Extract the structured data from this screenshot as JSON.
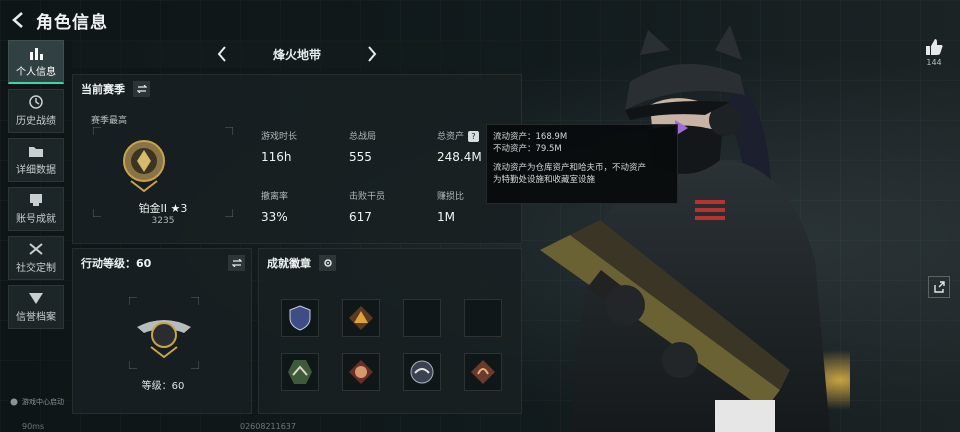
{
  "header": {
    "title": "角色信息"
  },
  "sidebar": {
    "items": [
      {
        "label": "个人信息",
        "icon": "bar-chart-icon",
        "active": true
      },
      {
        "label": "历史战绩",
        "icon": "history-icon"
      },
      {
        "label": "详细数据",
        "icon": "folder-icon"
      },
      {
        "label": "账号成就",
        "icon": "achievement-icon"
      },
      {
        "label": "社交定制",
        "icon": "tools-icon"
      },
      {
        "label": "信誉档案",
        "icon": "credit-icon"
      }
    ],
    "footer": "游戏中心启动"
  },
  "status": {
    "ping": "90ms",
    "uid": "02608211637"
  },
  "mode_nav": {
    "title": "烽火地带"
  },
  "season": {
    "title": "当前赛季",
    "best_label": "赛季最高",
    "rank_name": "铂金II ★3",
    "rank_points": "3235",
    "stats": [
      {
        "label": "游戏时长",
        "value": "116h"
      },
      {
        "label": "总战局",
        "value": "555"
      },
      {
        "label": "总资产",
        "value": "248.4M"
      },
      {
        "label": "撤离率",
        "value": "33%"
      },
      {
        "label": "击败干员",
        "value": "617"
      },
      {
        "label": "赚损比",
        "value": "1M"
      }
    ]
  },
  "tooltip": {
    "line1": "流动资产：168.9M",
    "line2": "不动资产：79.5M",
    "line3": "流动资产为仓库资产和哈夫币，不动资产",
    "line4": "为特勤处设施和收藏室设施"
  },
  "level": {
    "title": "行动等级：60",
    "level_text": "等级：60"
  },
  "badges": {
    "title": "成就徽章",
    "items": [
      "shield-badge",
      "triangle-badge",
      "",
      "",
      "wolf-badge",
      "fox-badge",
      "eagle-badge",
      "dragon-badge"
    ]
  },
  "likes": {
    "count": "144"
  },
  "colors": {
    "accent": "#3fd6a6",
    "gold": "#c9a24e"
  }
}
